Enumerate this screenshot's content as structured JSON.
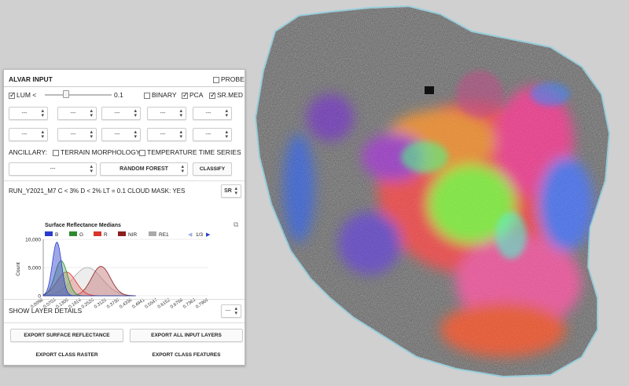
{
  "panel": {
    "title": "ALVAR INPUT",
    "probe_label": "PROBE",
    "lum_label": "LUM <",
    "lum_value": "0.1",
    "lum_slider_fraction": 0.32,
    "binary_label": "BINARY",
    "pca_label": "PCA",
    "srmed_label": "SR.MED",
    "dropdown_placeholder": "---",
    "ancillary_label": "ANCILLARY:",
    "terrain_label": "TERRAIN MORPHOLOGY",
    "temperature_label": "TEMPERATURE TIME SERIES",
    "classifier_placeholder": "---",
    "classifier_method": "RANDOM FOREST",
    "classify_label": "CLASSIFY",
    "run_text": "RUN_Y2021_M7 C < 3% D < 2% LT = 0.1 CLOUD MASK: YES",
    "run_select": "SR",
    "layer_details_label": "SHOW LAYER DETAILS",
    "layer_details_select": "---",
    "export_sr": "EXPORT SURFACE REFLECTANCE",
    "export_all": "EXPORT ALL INPUT LAYERS",
    "export_raster": "EXPORT CLASS RASTER",
    "export_features": "EXPORT CLASS FEATURES"
  },
  "icons": {
    "chevron": "up-down-chevron-icon",
    "popout": "external-link-icon",
    "pager_prev": "triangle-left-icon",
    "pager_next": "triangle-right-icon"
  },
  "chart_data": {
    "type": "area",
    "title": "Surface Reflectance Medians",
    "ylabel": "Count",
    "xlabel": "",
    "pager": "1/3",
    "ylim": [
      0,
      10000
    ],
    "yticks": [
      "0",
      "5,000",
      "10,000"
    ],
    "x_ticks": [
      "0.0098",
      "0.0703",
      "0.1309",
      "0.1914",
      "0.2520",
      "0.3125",
      "0.3730",
      "0.4336",
      "0.4941",
      "0.5547",
      "0.6152",
      "0.6758",
      "0.7363",
      "0.7969"
    ],
    "legend_position": "top",
    "series": [
      {
        "name": "B",
        "color": "#2a3ccf",
        "fill": "#2a3ccf",
        "peak": 0.075,
        "height": 9500,
        "width": 0.022
      },
      {
        "name": "G",
        "color": "#2e8b2e",
        "fill": "#6ab66a",
        "peak": 0.095,
        "height": 6200,
        "width": 0.03
      },
      {
        "name": "R",
        "color": "#d9342b",
        "fill": "#e88080",
        "peak": 0.12,
        "height": 4200,
        "width": 0.045
      },
      {
        "name": "NIR",
        "color": "#8b1e1e",
        "fill": "#c07070",
        "peak": 0.285,
        "height": 5200,
        "width": 0.045
      },
      {
        "name": "RE1",
        "color": "#aaaaaa",
        "fill": "#d8d8d8",
        "peak": 0.22,
        "height": 5000,
        "width": 0.07
      }
    ]
  }
}
